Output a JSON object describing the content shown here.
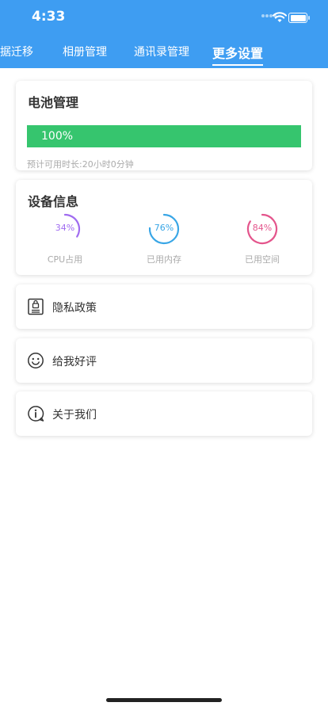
{
  "status_bar": {
    "time": "4:33"
  },
  "tabs": [
    {
      "label": "据迁移",
      "active": false
    },
    {
      "label": "相册管理",
      "active": false
    },
    {
      "label": "通讯录管理",
      "active": false
    },
    {
      "label": "更多设置",
      "active": true
    }
  ],
  "battery_card": {
    "title": "电池管理",
    "level_percent": 100,
    "level_label": "100%",
    "estimate": "预计可用时长:20小时0分钟"
  },
  "device_card": {
    "title": "设备信息",
    "gauges": [
      {
        "percent_label": "34%",
        "value": 34,
        "label": "CPU占用",
        "color": "#a06cf0"
      },
      {
        "percent_label": "76%",
        "value": 76,
        "label": "已用内存",
        "color": "#39a6e6"
      },
      {
        "percent_label": "84%",
        "value": 84,
        "label": "已用空间",
        "color": "#e4558c"
      }
    ]
  },
  "menu": [
    {
      "label": "隐私政策",
      "icon": "privacy-doc-icon"
    },
    {
      "label": "给我好评",
      "icon": "smiley-icon"
    },
    {
      "label": "关于我们",
      "icon": "info-bubble-icon"
    }
  ],
  "colors": {
    "header": "#3e9df2",
    "battery_bar": "#36c56e"
  }
}
